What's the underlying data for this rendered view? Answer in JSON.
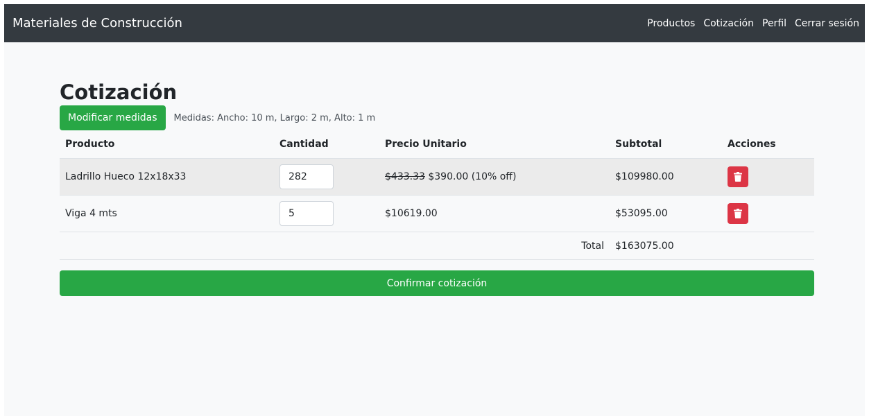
{
  "navbar": {
    "brand": "Materiales de Construcción",
    "links": [
      "Productos",
      "Cotización",
      "Perfil",
      "Cerrar sesión"
    ]
  },
  "page": {
    "title": "Cotización",
    "modify_button": "Modificar medidas",
    "measures": "Medidas: Ancho: 10 m, Largo: 2 m, Alto: 1 m"
  },
  "table": {
    "headers": [
      "Producto",
      "Cantidad",
      "Precio Unitario",
      "Subtotal",
      "Acciones"
    ],
    "rows": [
      {
        "product": "Ladrillo Hueco 12x18x33",
        "quantity": "282",
        "old_price": "$433.33",
        "price": "$390.00 (10% off)",
        "subtotal": "$109980.00",
        "action_icon": "trash-icon"
      },
      {
        "product": "Viga 4 mts",
        "quantity": "5",
        "price": "$10619.00",
        "subtotal": "$53095.00",
        "action_icon": "trash-icon"
      }
    ],
    "total_label": "Total",
    "total_value": "$163075.00"
  },
  "confirm_button": "Confirmar cotización",
  "colors": {
    "navbar": "#343a40",
    "success": "#28a745",
    "danger": "#dc3545",
    "background": "#f8f9fa"
  }
}
